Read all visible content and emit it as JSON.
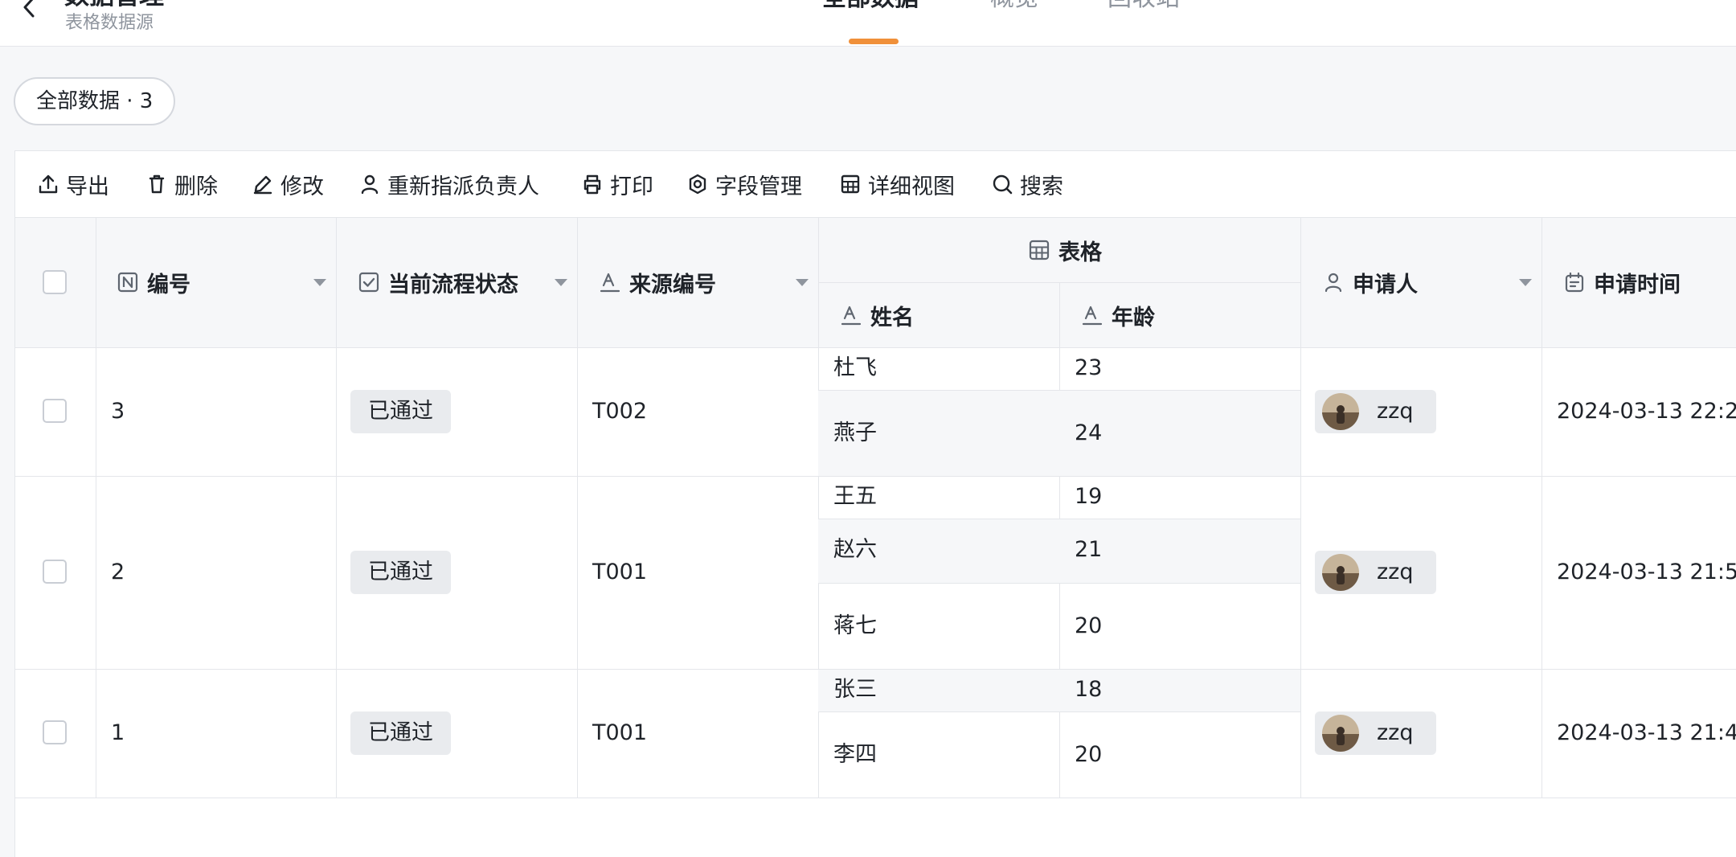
{
  "header": {
    "title": "数据管理",
    "subtitle": "表格数据源",
    "tabs": [
      {
        "label": "全部数据",
        "active": true
      },
      {
        "label": "概览",
        "active": false
      },
      {
        "label": "回收站",
        "active": false
      }
    ],
    "accent_color": "#f0903a"
  },
  "view_chip": {
    "label": "全部数据 · 3"
  },
  "toolbar": {
    "items": [
      {
        "label": "导出",
        "icon": "upload-icon"
      },
      {
        "label": "删除",
        "icon": "trash-icon"
      },
      {
        "label": "修改",
        "icon": "pencil-icon"
      },
      {
        "label": "重新指派负责人",
        "icon": "user-icon"
      },
      {
        "label": "打印",
        "icon": "printer-icon"
      },
      {
        "label": "字段管理",
        "icon": "settings-icon"
      },
      {
        "label": "详细视图",
        "icon": "grid-icon"
      },
      {
        "label": "搜索",
        "icon": "search-icon"
      }
    ]
  },
  "table": {
    "columns": {
      "id": "编号",
      "status": "当前流程状态",
      "source": "来源编号",
      "group": "表格",
      "name": "姓名",
      "age": "年龄",
      "applicant": "申请人",
      "time": "申请时间"
    },
    "rows": [
      {
        "id": "3",
        "status": "已通过",
        "source": "T002",
        "sub": [
          {
            "name": "杜飞",
            "age": "23"
          },
          {
            "name": "燕子",
            "age": "24"
          }
        ],
        "applicant": "zzq",
        "time": "2024-03-13 22:2"
      },
      {
        "id": "2",
        "status": "已通过",
        "source": "T001",
        "sub": [
          {
            "name": "王五",
            "age": "19"
          },
          {
            "name": "赵六",
            "age": "21"
          },
          {
            "name": "蒋七",
            "age": "20"
          }
        ],
        "applicant": "zzq",
        "time": "2024-03-13 21:5"
      },
      {
        "id": "1",
        "status": "已通过",
        "source": "T001",
        "sub": [
          {
            "name": "张三",
            "age": "18"
          },
          {
            "name": "李四",
            "age": "20"
          }
        ],
        "applicant": "zzq",
        "time": "2024-03-13 21:4"
      }
    ]
  }
}
